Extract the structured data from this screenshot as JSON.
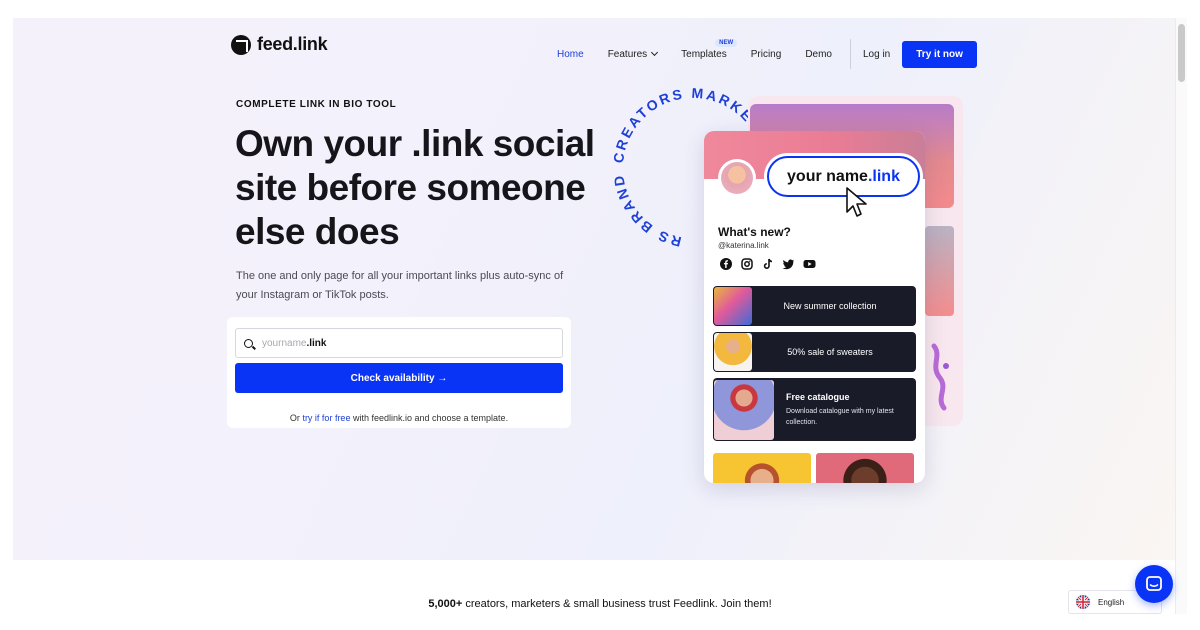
{
  "logo": {
    "text": "feed.link"
  },
  "nav": {
    "items": [
      {
        "label": "Home",
        "active": true
      },
      {
        "label": "Features",
        "dropdown": true
      },
      {
        "label": "Templates",
        "badge": "NEW"
      },
      {
        "label": "Pricing"
      },
      {
        "label": "Demo"
      }
    ],
    "login_label": "Log in",
    "cta_label": "Try it now"
  },
  "hero": {
    "eyebrow": "COMPLETE LINK IN BIO TOOL",
    "headline": "Own your .link social site before someone else does",
    "subtext": "The one and only page for all your important links plus auto-sync of your Instagram or TikTok posts.",
    "search": {
      "placeholder": "yourname",
      "suffix": ".link"
    },
    "check_button": "Check availability →",
    "footnote_prefix": "Or",
    "footnote_link": "try if for free",
    "footnote_suffix": "with feedlink.io and choose a template."
  },
  "visual": {
    "ring_text": "CREATORS MARKETERS BRANDS",
    "ring_top": "CREATORS MARKETERS",
    "ring_bottom": "RS BRANDS",
    "pill_prefix": "your name",
    "pill_suffix": ".link",
    "profile_title": "What's new?",
    "profile_handle": "@katerina.link",
    "social_icons": [
      "facebook-icon",
      "instagram-icon",
      "tiktok-icon",
      "twitter-icon",
      "youtube-icon"
    ],
    "links": [
      {
        "label": "New summer collection"
      },
      {
        "label": "50% sale of sweaters"
      },
      {
        "label": "Free catalogue",
        "description": "Download catalogue with my latest collection."
      }
    ]
  },
  "trust": {
    "bold": "5,000+",
    "text": "creators, marketers & small business trust Feedlink. Join them!"
  },
  "language": {
    "label": "English"
  },
  "colors": {
    "brand_blue": "#0a34f5",
    "link_blue": "#1e40d6",
    "dark_card": "#1a1b29"
  }
}
